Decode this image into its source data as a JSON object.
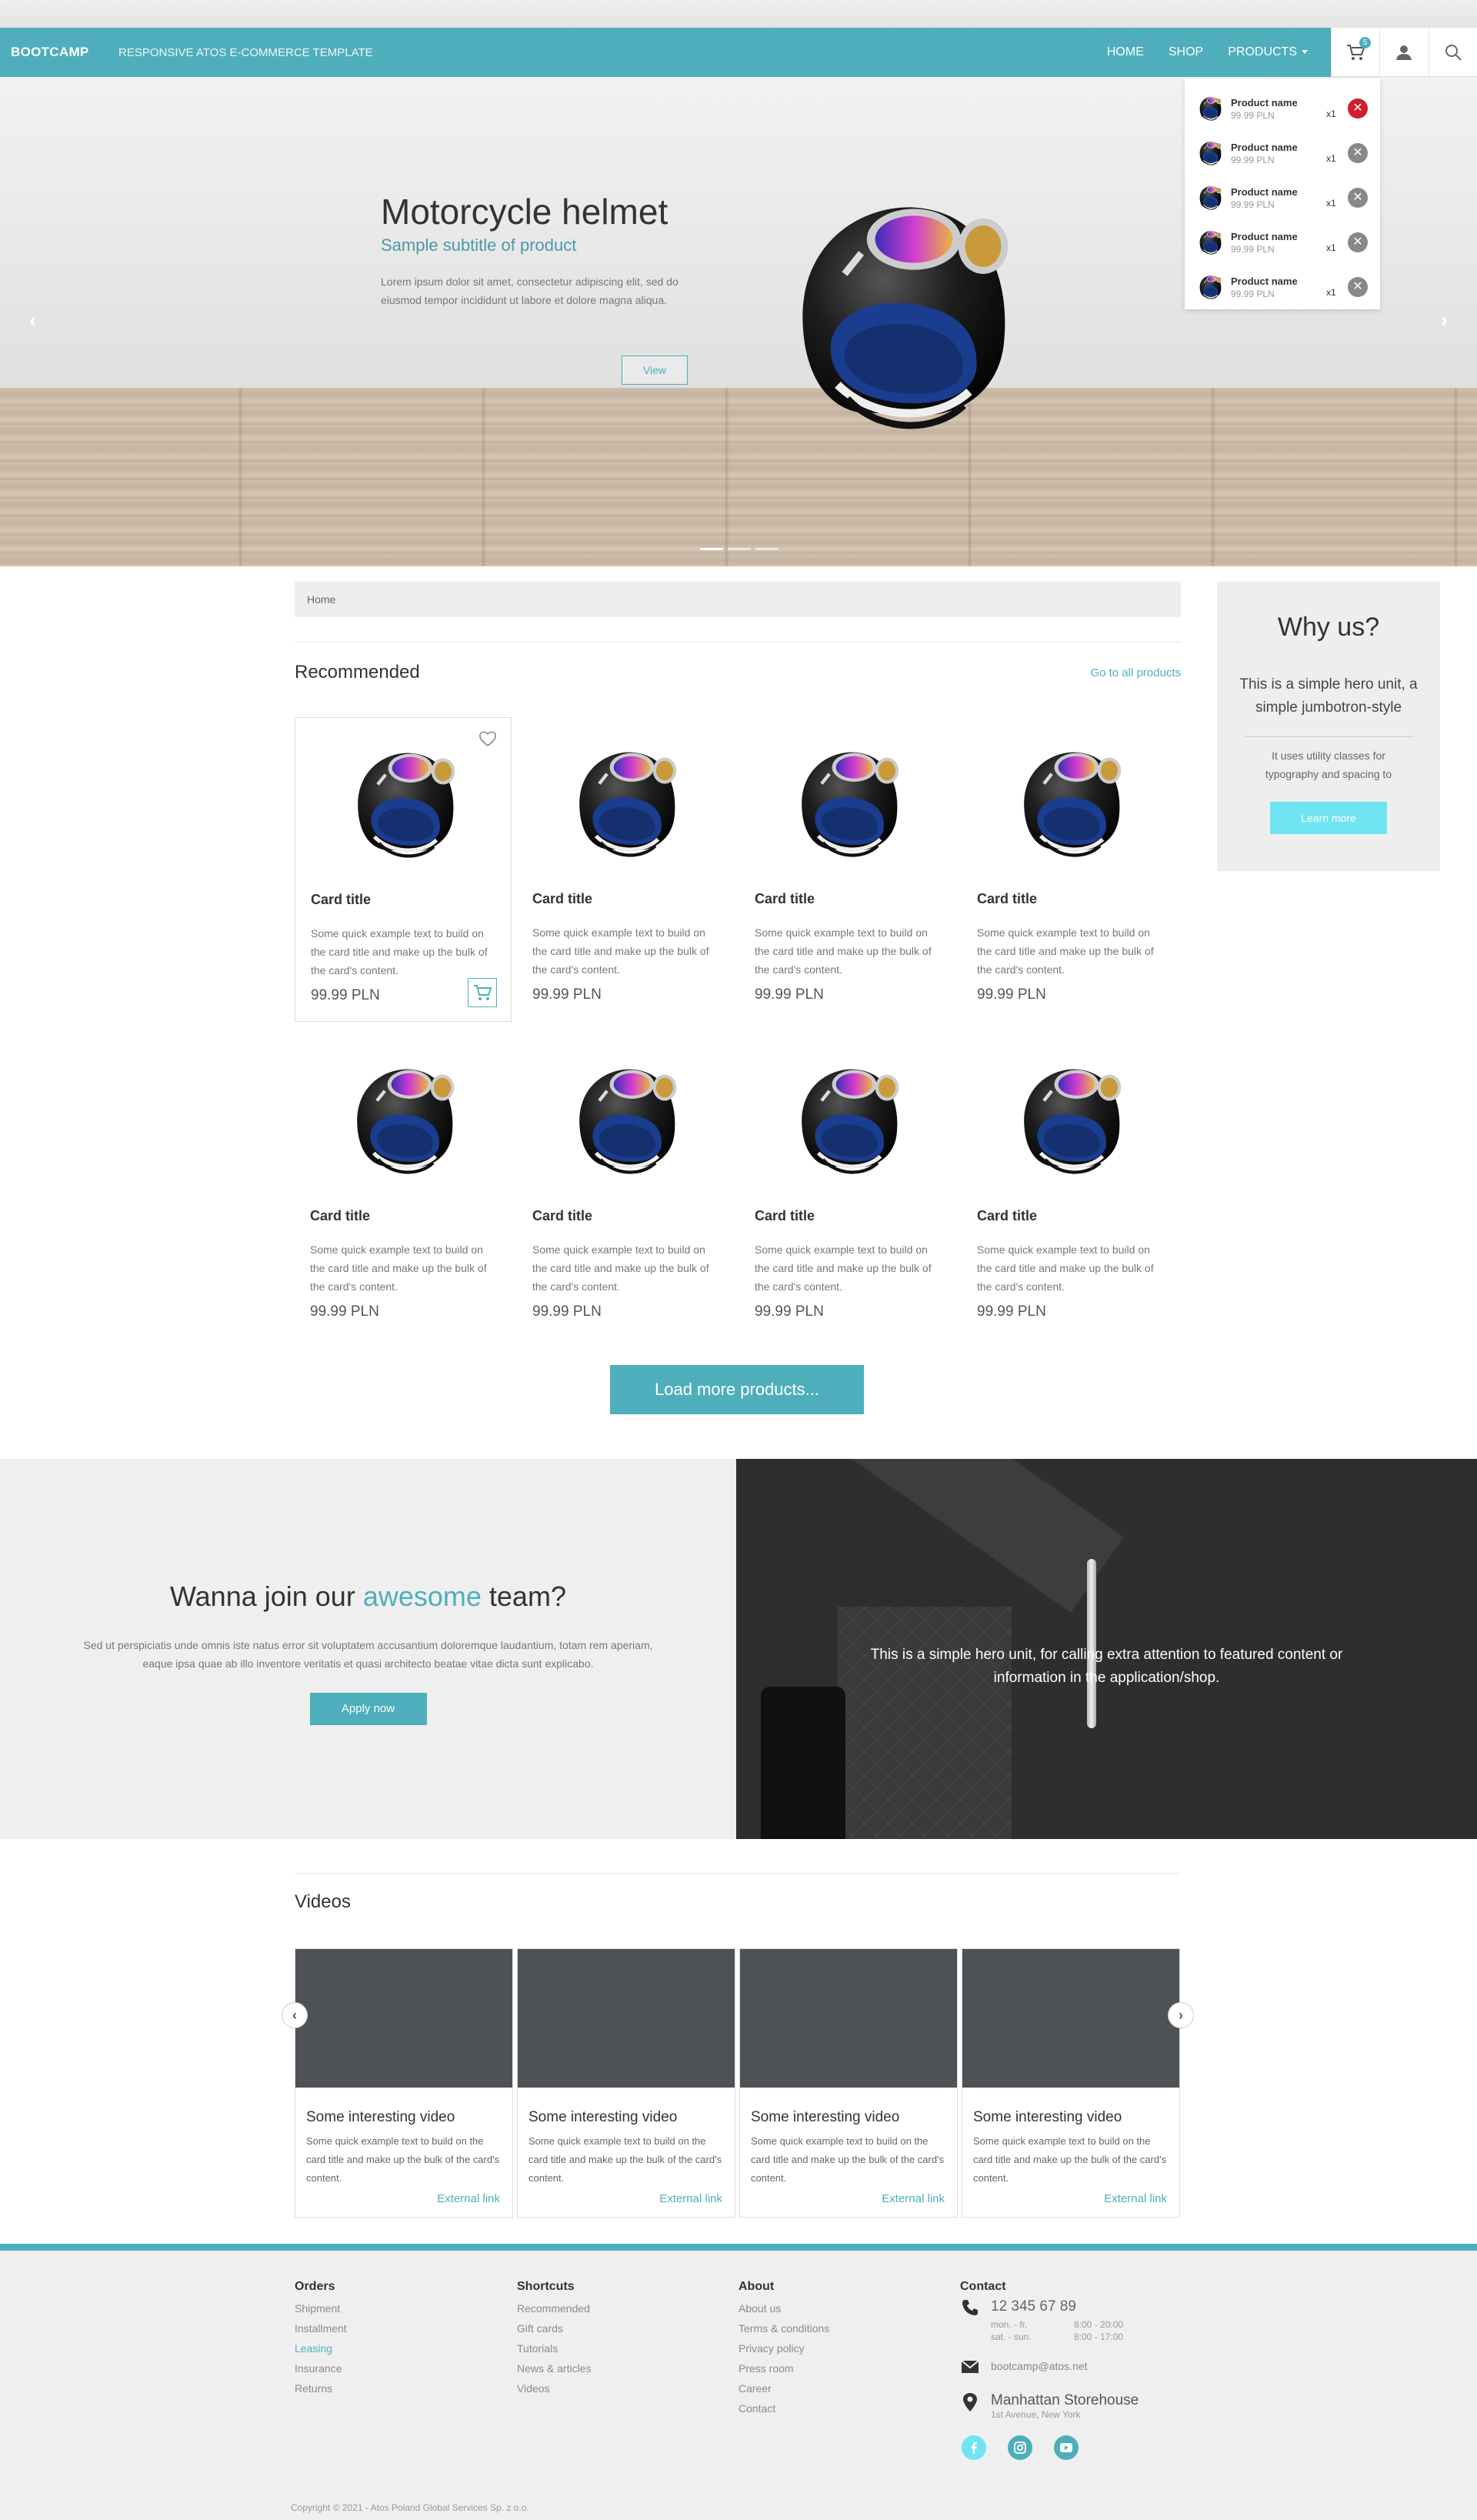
{
  "navbar": {
    "brand": "BOOTCAMP",
    "tagline": "RESPONSIVE ATOS E-COMMERCE TEMPLATE",
    "links": [
      "HOME",
      "SHOP",
      "PRODUCTS"
    ],
    "cart_count": "5"
  },
  "hero": {
    "title": "Motorcycle helmet",
    "subtitle": "Sample subtitle of product",
    "text": "Lorem ipsum dolor sit amet, consectetur adipiscing elit, sed do eiusmod tempor incididunt ut labore et dolore magna aliqua.",
    "button": "View",
    "prev": "‹",
    "next": "›",
    "slides": 3,
    "active_slide": 1
  },
  "cart_dropdown": {
    "items": [
      {
        "name": "Product name",
        "price": "99.99 PLN",
        "qty": "x1",
        "remove": "✕"
      },
      {
        "name": "Product name",
        "price": "99.99 PLN",
        "qty": "x1",
        "remove": "✕"
      },
      {
        "name": "Product name",
        "price": "99.99 PLN",
        "qty": "x1",
        "remove": "✕"
      },
      {
        "name": "Product name",
        "price": "99.99 PLN",
        "qty": "x1",
        "remove": "✕"
      },
      {
        "name": "Product name",
        "price": "99.99 PLN",
        "qty": "x1",
        "remove": "✕"
      }
    ]
  },
  "breadcrumb": "Home",
  "recommended": {
    "title": "Recommended",
    "all_link": "Go to all products",
    "cards": [
      {
        "title": "Card title",
        "text": "Some quick example text to build on the card title and make up the bulk of the card's content.",
        "price": "99.99 PLN"
      },
      {
        "title": "Card title",
        "text": "Some quick example text to build on the card title and make up the bulk of the card's content.",
        "price": "99.99 PLN"
      },
      {
        "title": "Card title",
        "text": "Some quick example text to build on the card title and make up the bulk of the card's content.",
        "price": "99.99 PLN"
      },
      {
        "title": "Card title",
        "text": "Some quick example text to build on the card title and make up the bulk of the card's content.",
        "price": "99.99 PLN"
      },
      {
        "title": "Card title",
        "text": "Some quick example text to build on the card title and make up the bulk of the card's content.",
        "price": "99.99 PLN"
      },
      {
        "title": "Card title",
        "text": "Some quick example text to build on the card title and make up the bulk of the card's content.",
        "price": "99.99 PLN"
      },
      {
        "title": "Card title",
        "text": "Some quick example text to build on the card title and make up the bulk of the card's content.",
        "price": "99.99 PLN"
      },
      {
        "title": "Card title",
        "text": "Some quick example text to build on the card title and make up the bulk of the card's content.",
        "price": "99.99 PLN"
      }
    ],
    "load_more": "Load more products..."
  },
  "why_us": {
    "title": "Why us?",
    "lead": "This is a simple hero unit, a simple jumbotron-style",
    "small": "It uses utility classes for typography and spacing to",
    "button": "Learn more"
  },
  "join": {
    "title_pre": "Wanna join our ",
    "title_hl": "awesome",
    "title_post": " team?",
    "text": "Sed ut perspiciatis unde omnis iste natus error sit voluptatem accusantium doloremque laudantium, totam rem aperiam, eaque ipsa quae ab illo inventore veritatis et quasi architecto beatae vitae dicta sunt explicabo.",
    "button": "Apply now"
  },
  "dark_hero": {
    "text": "This is a simple hero unit, for calling extra attention to featured content or information in the application/shop."
  },
  "videos": {
    "title": "Videos",
    "prev": "‹",
    "next": "›",
    "items": [
      {
        "title": "Some interesting video",
        "text": "Some quick example text to build on the card title and make up the bulk of the card's content.",
        "link": "External link"
      },
      {
        "title": "Some interesting video",
        "text": "Some quick example text to build on the card title and make up the bulk of the card's content.",
        "link": "External link"
      },
      {
        "title": "Some interesting video",
        "text": "Some quick example text to build on the card title and make up the bulk of the card's content.",
        "link": "External link"
      },
      {
        "title": "Some interesting video",
        "text": "Some quick example text to build on the card title and make up the bulk of the card's content.",
        "link": "External link"
      }
    ]
  },
  "footer": {
    "orders": {
      "title": "Orders",
      "links": [
        "Shipment",
        "Installment",
        "Leasing",
        "Insurance",
        "Returns"
      ]
    },
    "shortcuts": {
      "title": "Shortcuts",
      "links": [
        "Recommended",
        "Gift cards",
        "Tutorials",
        "News & articles",
        "Videos"
      ]
    },
    "about": {
      "title": "About",
      "links": [
        "About us",
        "Terms & conditions",
        "Privacy policy",
        "Press room",
        "Career",
        "Contact"
      ]
    },
    "contact": {
      "title": "Contact",
      "phone": "12 345 67 89",
      "hours": [
        [
          "mon. - fr.",
          "8:00 - 20:00"
        ],
        [
          "sat. - sun.",
          "8:00 - 17:00"
        ]
      ],
      "email": "bootcamp@atos.net",
      "store": "Manhattan Storehouse",
      "address": "1st Avenue, New York"
    },
    "copyright": "Copyright © 2021 - Atos Poland Global Services Sp. z o.o."
  },
  "colors": {
    "accent": "#4faebb",
    "accent_light": "#6fe4f2",
    "danger": "#d01e2a",
    "dark": "#2e2e2e"
  }
}
